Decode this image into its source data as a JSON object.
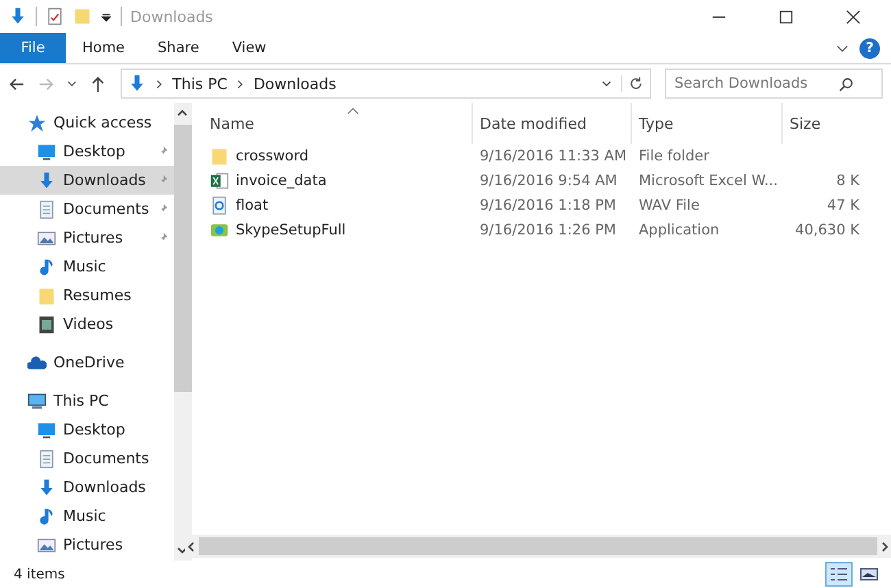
{
  "window": {
    "title": "Downloads"
  },
  "ribbon_tabs": [
    {
      "label": "File",
      "selected": true
    },
    {
      "label": "Home",
      "selected": false
    },
    {
      "label": "Share",
      "selected": false
    },
    {
      "label": "View",
      "selected": false
    }
  ],
  "help_button": {
    "label": "?"
  },
  "address": {
    "crumbs": [
      "This PC",
      "Downloads"
    ]
  },
  "search": {
    "placeholder": "Search Downloads"
  },
  "sidebar": {
    "items": [
      {
        "label": "Quick access",
        "kind": "star",
        "selected": false,
        "children": [
          {
            "label": "Desktop",
            "kind": "desktop",
            "pinned": true,
            "selected": false
          },
          {
            "label": "Downloads",
            "kind": "download",
            "pinned": true,
            "selected": true
          },
          {
            "label": "Documents",
            "kind": "document",
            "pinned": true,
            "selected": false
          },
          {
            "label": "Pictures",
            "kind": "pictures",
            "pinned": true,
            "selected": false
          },
          {
            "label": "Music",
            "kind": "music",
            "pinned": false,
            "selected": false
          },
          {
            "label": "Resumes",
            "kind": "folder",
            "pinned": false,
            "selected": false
          },
          {
            "label": "Videos",
            "kind": "videos",
            "pinned": false,
            "selected": false
          }
        ]
      },
      {
        "label": "OneDrive",
        "kind": "cloud",
        "selected": false
      },
      {
        "label": "This PC",
        "kind": "pc",
        "selected": false,
        "children": [
          {
            "label": "Desktop",
            "kind": "desktop",
            "pinned": false,
            "selected": false
          },
          {
            "label": "Documents",
            "kind": "document",
            "pinned": false,
            "selected": false
          },
          {
            "label": "Downloads",
            "kind": "download",
            "pinned": false,
            "selected": false
          },
          {
            "label": "Music",
            "kind": "music",
            "pinned": false,
            "selected": false
          },
          {
            "label": "Pictures",
            "kind": "pictures",
            "pinned": false,
            "selected": false
          }
        ]
      }
    ]
  },
  "table": {
    "columns": [
      "Name",
      "Date modified",
      "Type",
      "Size"
    ],
    "rows": [
      {
        "kind": "folder",
        "name": "crossword",
        "date": "9/16/2016 11:33 AM",
        "type": "File folder"
      },
      {
        "kind": "excel",
        "name": "invoice_data",
        "date": "9/16/2016 9:54 AM",
        "type": "Microsoft Excel W...",
        "size": "8 K"
      },
      {
        "kind": "audio",
        "name": "float",
        "date": "9/16/2016 1:18 PM",
        "type": "WAV File",
        "size": "47 K"
      },
      {
        "kind": "app",
        "name": "SkypeSetupFull",
        "date": "9/16/2016 1:26 PM",
        "type": "Application",
        "size": "40,630 K"
      }
    ]
  },
  "status_bar": {
    "text": "4 items",
    "views": [
      {
        "kind": "details",
        "selected": true
      },
      {
        "kind": "large",
        "selected": false
      }
    ]
  }
}
